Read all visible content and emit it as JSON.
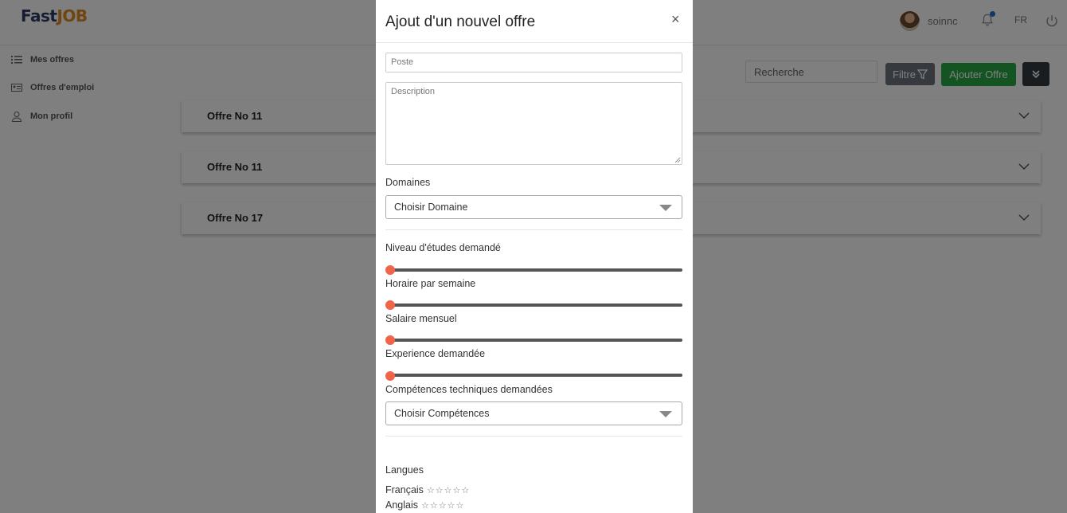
{
  "header": {
    "logo_part1": "Fast",
    "logo_part2": "JOB",
    "username": "soinnc",
    "language": "FR"
  },
  "sidebar": {
    "items": [
      {
        "label": "Mes offres",
        "icon": "list-icon"
      },
      {
        "label": "Offres d'emploi",
        "icon": "id-card-icon"
      },
      {
        "label": "Mon profil",
        "icon": "user-icon"
      }
    ]
  },
  "toolbar": {
    "search_placeholder": "Recherche",
    "filter_label": "Filtre",
    "add_label": "Ajouter Offre"
  },
  "offers": [
    {
      "title": "Offre No 11"
    },
    {
      "title": "Offre No 11"
    },
    {
      "title": "Offre No 17"
    }
  ],
  "modal": {
    "title": "Ajout d'un nouvel offre",
    "close": "×",
    "poste_placeholder": "Poste",
    "description_placeholder": "Description",
    "domaines_label": "Domaines",
    "domaines_value": "Choisir Domaine",
    "sliders": [
      {
        "label": "Niveau d'études demandé",
        "value": 0
      },
      {
        "label": "Horaire par semaine",
        "value": 0
      },
      {
        "label": "Salaire mensuel",
        "value": 0
      },
      {
        "label": "Experience demandée",
        "value": 0
      }
    ],
    "competences_label": "Compétences techniques demandées",
    "competences_value": "Choisir Compétences",
    "langues_label": "Langues",
    "langues": [
      {
        "name": "Français",
        "stars": "☆☆☆☆☆"
      },
      {
        "name": "Anglais",
        "stars": "☆☆☆☆☆"
      }
    ]
  },
  "colors": {
    "accent_green": "#28a745",
    "slider_thumb": "#f06449",
    "logo_blue": "#2d3a66",
    "logo_orange": "#e08a1e"
  }
}
